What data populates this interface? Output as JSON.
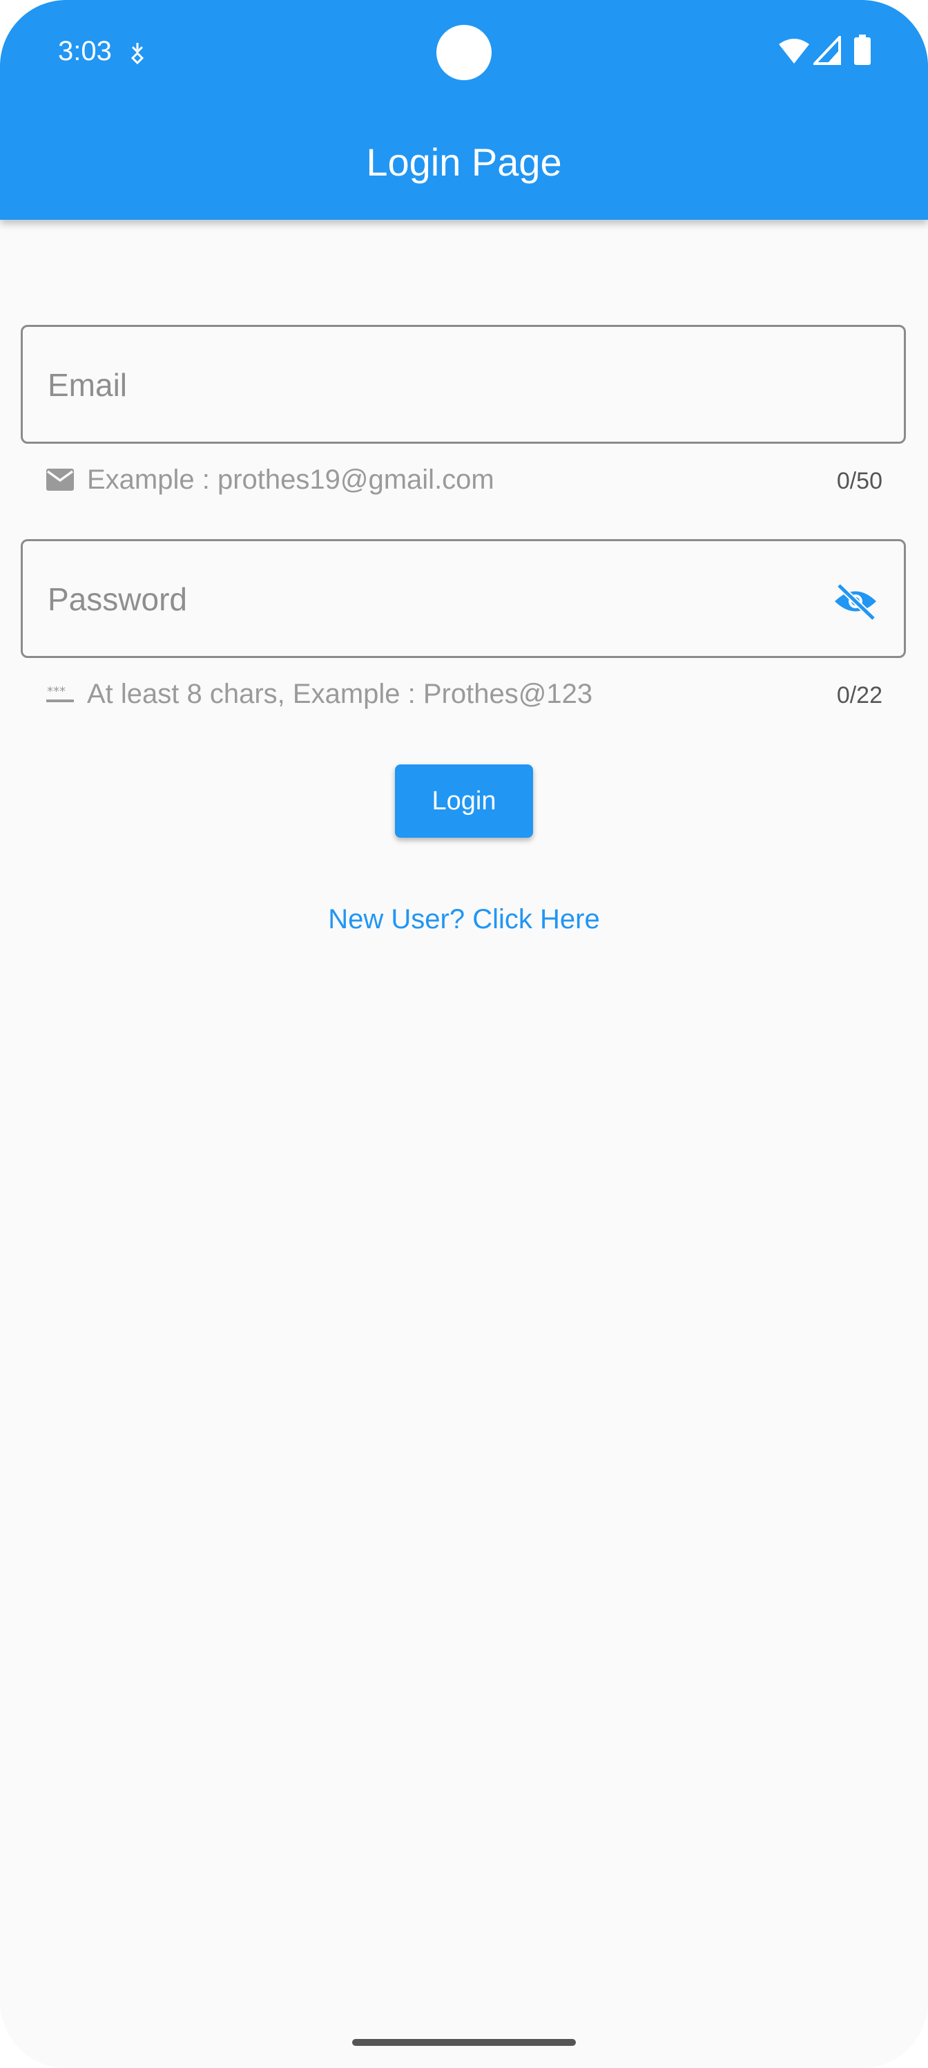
{
  "status_bar": {
    "time": "3:03"
  },
  "app_bar": {
    "title": "Login Page",
    "color": "#2196f3"
  },
  "form": {
    "email": {
      "placeholder": "Email",
      "value": "",
      "helper_text": "Example : prothes19@gmail.com",
      "counter": "0/50",
      "icon": "email-icon"
    },
    "password": {
      "placeholder": "Password",
      "value": "",
      "helper_text": "At least 8 chars, Example : Prothes@123",
      "counter": "0/22",
      "icon": "password-dots-icon",
      "visibility_icon": "eye-off-icon"
    },
    "login_label": "Login",
    "new_user_label": "New User? Click Here"
  }
}
